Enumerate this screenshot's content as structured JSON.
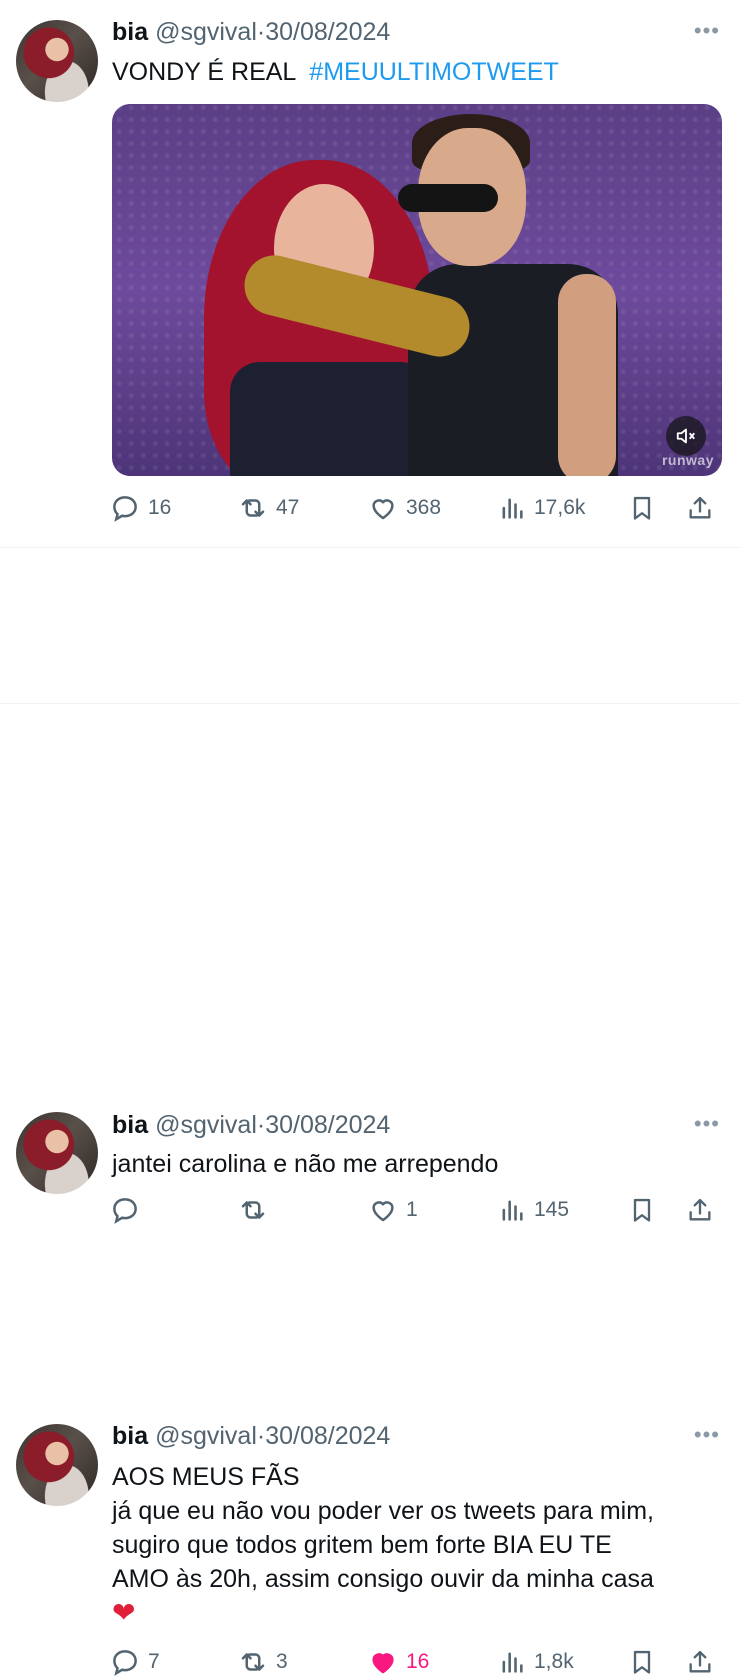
{
  "tweets": [
    {
      "name": "bia",
      "handle": "@sgvival",
      "separator": "·",
      "date": "30/08/2024",
      "more": "•••",
      "text": "VONDY É REAL  ",
      "hashtag": "#MEUULTIMOTWEET",
      "media": {
        "watermark": "runway",
        "mute_icon": "mute-icon"
      },
      "stats": {
        "replies": "16",
        "retweets": "47",
        "likes": "368",
        "views": "17,6k"
      }
    },
    {
      "name": "bia",
      "handle": "@sgvival",
      "separator": "·",
      "date": "30/08/2024",
      "more": "•••",
      "text": "jantei carolina e não me arrependo",
      "stats": {
        "replies": "",
        "retweets": "",
        "likes": "1",
        "views": "145"
      }
    },
    {
      "name": "bia",
      "handle": "@sgvival",
      "separator": "·",
      "date": "30/08/2024",
      "more": "•••",
      "text": "AOS MEUS FÃS\njá que eu não vou poder ver os tweets para mim,\nsugiro que todos gritem bem forte BIA EU TE\nAMO às 20h, assim consigo ouvir da minha casa\n",
      "emoji": "❤",
      "stats": {
        "replies": "7",
        "retweets": "3",
        "likes": "16",
        "views": "1,8k"
      }
    }
  ],
  "colors": {
    "accent": "#1d9bf0",
    "like_active": "#f91880",
    "muted": "#536471"
  }
}
